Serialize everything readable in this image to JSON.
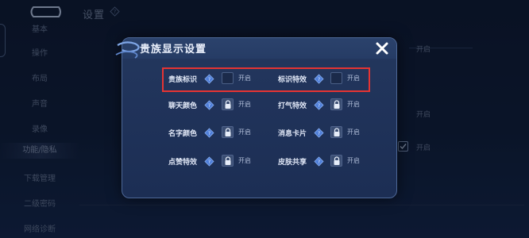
{
  "background": {
    "title": "设置",
    "sidebar": [
      {
        "label": "基本",
        "active": false
      },
      {
        "label": "操作",
        "active": false
      },
      {
        "label": "布局",
        "active": false
      },
      {
        "label": "声音",
        "active": false
      },
      {
        "label": "录像",
        "active": false
      },
      {
        "label": "功能/隐私",
        "active": true
      },
      {
        "label": "下载管理",
        "active": false
      },
      {
        "label": "二级密码",
        "active": false
      },
      {
        "label": "网络诊断",
        "active": false
      }
    ],
    "right_items": [
      "开启",
      "开启",
      "开启"
    ]
  },
  "dialog": {
    "title": "贵族显示设置",
    "options": [
      {
        "label": "贵族标识",
        "control": "checkbox",
        "state": "开启",
        "highlighted": true
      },
      {
        "label": "标识特效",
        "control": "checkbox",
        "state": "开启",
        "highlighted": true
      },
      {
        "label": "聊天颜色",
        "control": "locked",
        "state": "开启",
        "highlighted": false
      },
      {
        "label": "打气特效",
        "control": "locked",
        "state": "开启",
        "highlighted": false
      },
      {
        "label": "名字颜色",
        "control": "locked",
        "state": "开启",
        "highlighted": false
      },
      {
        "label": "消息卡片",
        "control": "locked",
        "state": "开启",
        "highlighted": false
      },
      {
        "label": "点赞特效",
        "control": "locked",
        "state": "开启",
        "highlighted": false
      },
      {
        "label": "皮肤共享",
        "control": "locked",
        "state": "开启",
        "highlighted": false
      }
    ]
  },
  "colors": {
    "highlight": "#e53433",
    "dialog_bg": "#20335a",
    "accent_icon": "#4f7fd9"
  }
}
